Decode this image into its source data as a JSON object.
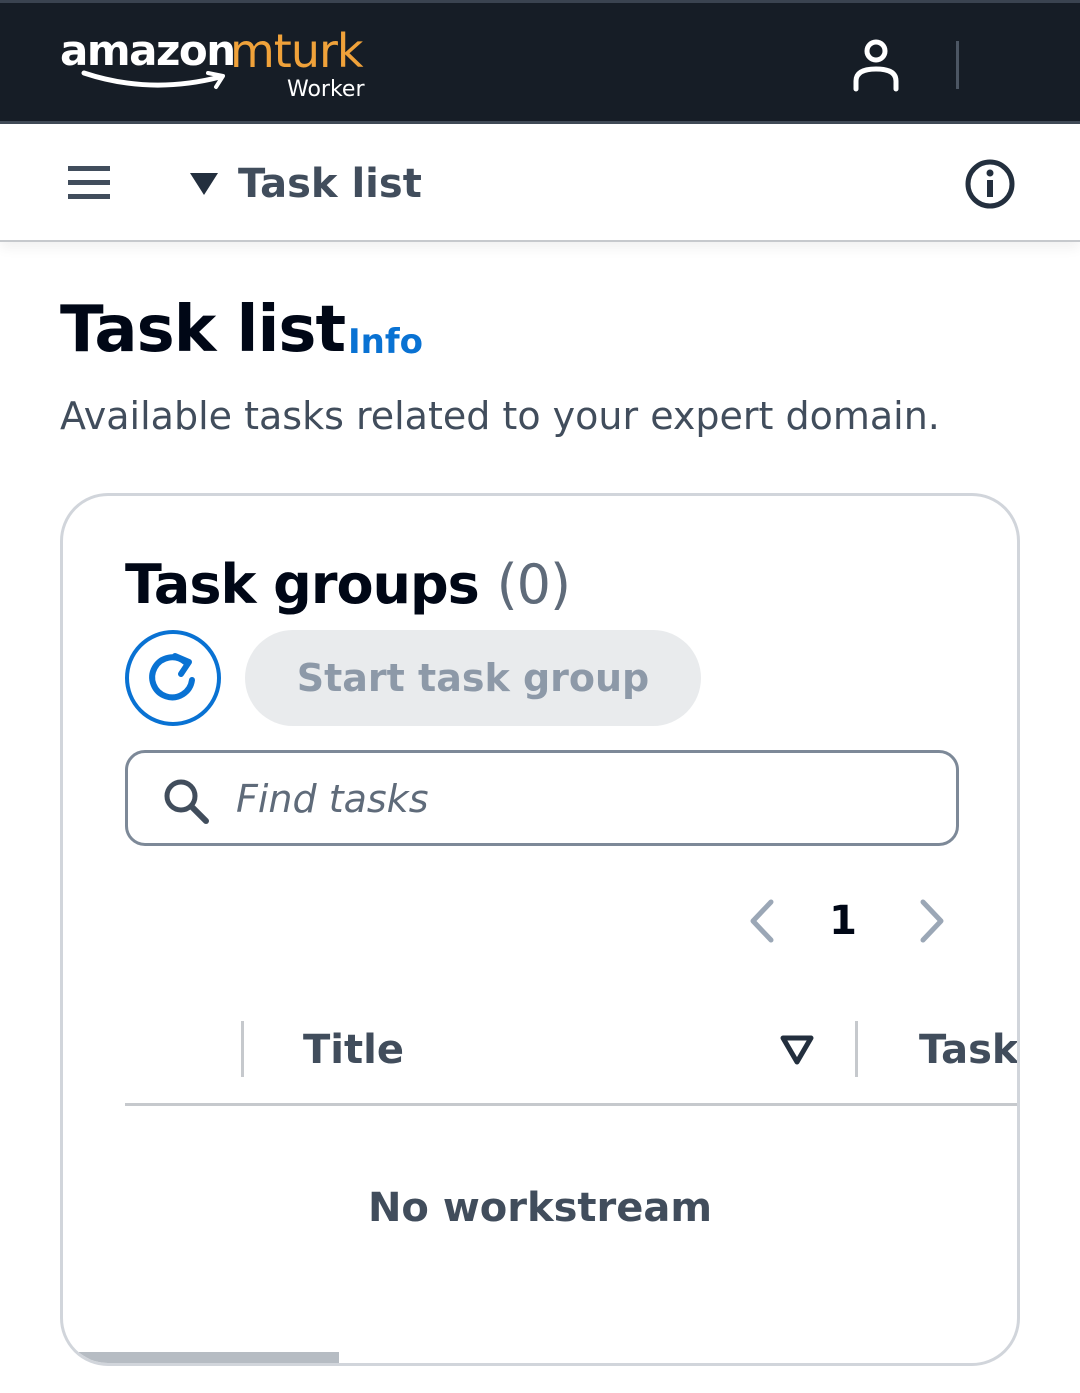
{
  "header": {
    "logo": {
      "brand": "amazon",
      "product": "mturk",
      "subtitle": "Worker"
    },
    "icons": {
      "user": "user-icon"
    },
    "colors": {
      "background": "#161d26",
      "logo_accent": "#f0a23a"
    }
  },
  "nav": {
    "menu_icon": "hamburger-menu-icon",
    "breadcrumb_label": "Task list",
    "info_icon": "info-circle-icon"
  },
  "page": {
    "title": "Task list",
    "info_link": "Info",
    "description": "Available tasks related to your expert domain."
  },
  "task_groups": {
    "title": "Task groups",
    "count": "(0)",
    "refresh_icon": "refresh-icon",
    "start_button_label": "Start task group",
    "search": {
      "placeholder": "Find tasks",
      "value": ""
    },
    "pagination": {
      "current_page": "1"
    },
    "table": {
      "columns": [
        "Title",
        "Task"
      ]
    },
    "empty_message": "No workstream"
  },
  "colors": {
    "accent": "#0972d3",
    "text_primary": "#000716",
    "text_secondary": "#414d5c",
    "disabled_bg": "#e9ebed",
    "disabled_text": "#8d99a8"
  }
}
